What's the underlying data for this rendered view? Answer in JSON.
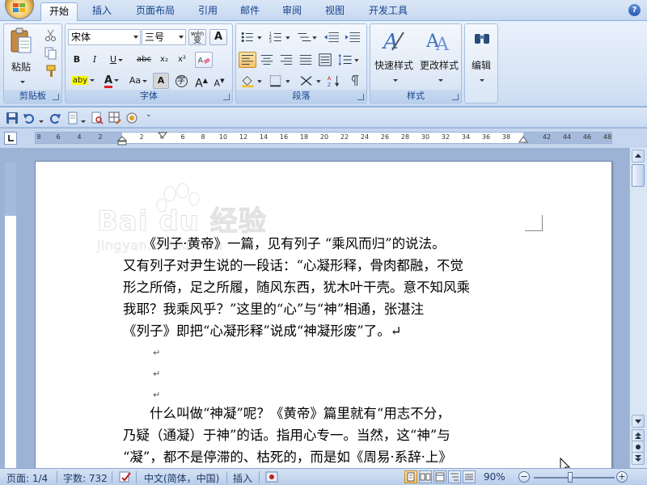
{
  "tabs": [
    {
      "label": "开始",
      "active": true
    },
    {
      "label": "插入"
    },
    {
      "label": "页面布局"
    },
    {
      "label": "引用"
    },
    {
      "label": "邮件"
    },
    {
      "label": "审阅"
    },
    {
      "label": "视图"
    },
    {
      "label": "开发工具"
    }
  ],
  "help_label": "?",
  "ribbon": {
    "clipboard": {
      "paste_label": "粘贴",
      "group_label": "剪贴板"
    },
    "font": {
      "font_name": "宋体",
      "font_size": "三号",
      "phonetic_label": "wén",
      "phonetic_char": "变",
      "border_char": "A",
      "bold": "B",
      "italic": "I",
      "underline": "U",
      "strike": "abc",
      "subscript": "x₂",
      "superscript": "x²",
      "highlight": "aby",
      "font_color": "A",
      "change_case": "Aa",
      "shading_char": "A",
      "enclose_char": "字",
      "grow": "A",
      "shrink": "A",
      "group_label": "字体"
    },
    "paragraph": {
      "group_label": "段落"
    },
    "styles": {
      "quick_label": "快速样式",
      "change_label": "更改样式",
      "group_label": "样式"
    },
    "editing": {
      "label": "编辑"
    }
  },
  "ruler_ticks": [
    "8",
    "6",
    "4",
    "2",
    "2",
    "4",
    "6",
    "8",
    "10",
    "12",
    "14",
    "16",
    "18",
    "20",
    "22",
    "24",
    "26",
    "28",
    "30",
    "32",
    "34",
    "36",
    "38",
    "42",
    "44",
    "46",
    "48"
  ],
  "document": {
    "watermark_text": "Bai  du 经验",
    "watermark_sub": "jingyan.baidu.com",
    "paragraphs": [
      "　　《列子·黄帝》一篇，见有列子 “乘风而归”的说法。",
      "又有列子对尹生说的一段话：“心凝形释，骨肉都融，不觉",
      "形之所倚，足之所履，随风东西，犹木叶干壳。意不知风乘",
      "我耶？我乘风乎？”这里的“心”与“神”相通，张湛注",
      "《列子》即把“心凝形释”说成“神凝形废”了。↵",
      "　　什么叫做“神凝”呢？《黄帝》篇里就有“用志不分，",
      "乃疑（通凝）于神”的话。指用心专一。当然，这“神”与",
      "“凝”，都不是停滞的、枯死的，而是如《周易·系辞·上》"
    ],
    "return_mark": "↵"
  },
  "status": {
    "page": "页面: 1/4",
    "words": "字数: 732",
    "language": "中文(简体，中国)",
    "mode": "插入",
    "zoom": "90%",
    "zoom_minus": "−",
    "zoom_plus": "+",
    "zoom_fraction": 0.45
  }
}
